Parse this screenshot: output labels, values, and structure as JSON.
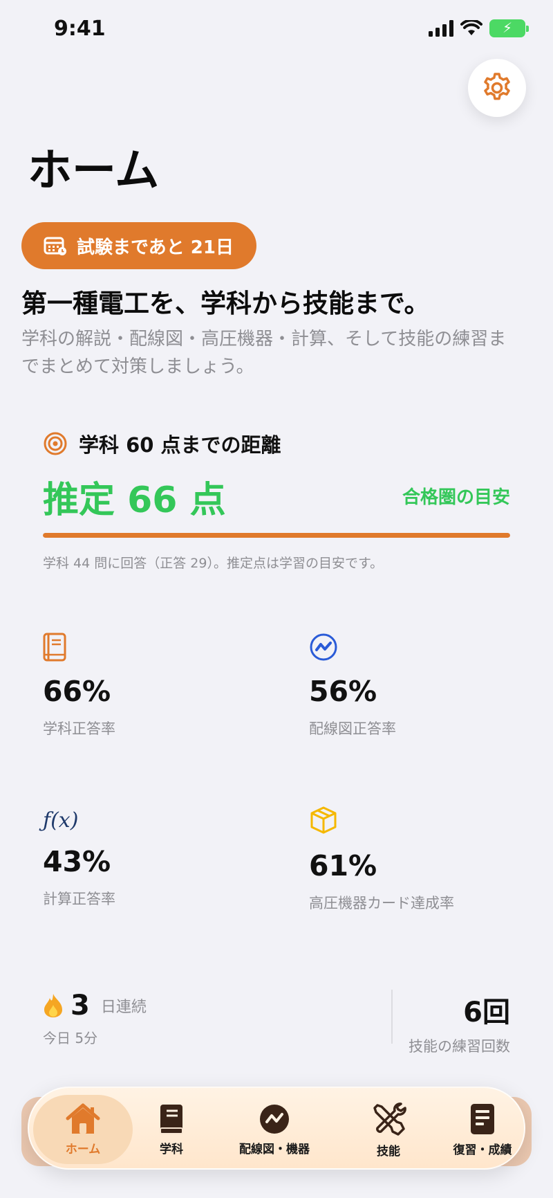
{
  "status": {
    "time": "9:41"
  },
  "header": {
    "title": "ホーム"
  },
  "countdown": {
    "label": "試験まであと 21日"
  },
  "intro": {
    "headline": "第一種電工を、学科から技能まで。",
    "description": "学科の解説・配線図・高圧機器・計算、そして技能の練習までまとめて対策しましょう。"
  },
  "target": {
    "title": "学科 60 点までの距離",
    "score": "推定 66 点",
    "note": "合格圏の目安",
    "progress_percent": 100,
    "footnote": "学科 44 問に回答（正答 29）。推定点は学習の目安です。"
  },
  "stats": [
    {
      "value": "66%",
      "label": "学科正答率",
      "icon": "book-icon"
    },
    {
      "value": "56%",
      "label": "配線図正答率",
      "icon": "wiring-icon"
    },
    {
      "value": "43%",
      "label": "計算正答率",
      "icon": "function-icon",
      "icon_text": "ƒ(x)"
    },
    {
      "value": "61%",
      "label": "高圧機器カード達成率",
      "icon": "box-icon"
    }
  ],
  "streak": {
    "days": "3",
    "unit": "日連続",
    "today": "今日 5分"
  },
  "practice": {
    "count": "6回",
    "label": "技能の練習回数"
  },
  "tabs": [
    {
      "label": "ホーム",
      "icon": "home-icon",
      "active": true
    },
    {
      "label": "学科",
      "icon": "book-icon"
    },
    {
      "label": "配線図・機器",
      "icon": "wiring-icon"
    },
    {
      "label": "技能",
      "icon": "tools-icon"
    },
    {
      "label": "復習・成績",
      "icon": "notes-icon"
    }
  ],
  "colors": {
    "accent": "#e07a2c",
    "success": "#34c759",
    "blue": "#2a5bd7",
    "yellow": "#f5b800",
    "navy": "#1f3a6b"
  }
}
